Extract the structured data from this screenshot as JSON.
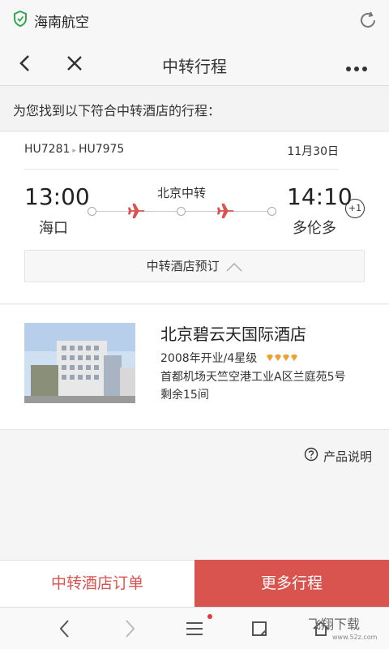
{
  "status_bar": {
    "app_name": "海南航空",
    "icons": [
      "shield-icon",
      "refresh-icon"
    ]
  },
  "nav": {
    "title": "中转行程",
    "icons": [
      "back-arrow-icon",
      "close-icon",
      "more-dots-icon"
    ]
  },
  "found_text": "为您找到以下符合中转酒店的行程：",
  "itinerary": {
    "flight1": "HU7281",
    "flight2": "HU7975",
    "separator": "▸",
    "date": "11月30日",
    "dep_time": "13:00",
    "dep_city": "海口",
    "transfer_label": "北京中转",
    "arr_time": "14:10",
    "arr_city": "多伦多",
    "plus_day": "+1",
    "hotel_booking_label": "中转酒店预订"
  },
  "hotel": {
    "name": "北京碧云天国际酒店",
    "year_rating": "2008年开业/4星级",
    "diamonds": 4,
    "address": "首都机场天竺空港工业A区兰庭苑5号",
    "rooms_left": "剩余15间"
  },
  "product_desc_label": "产品说明",
  "actions": {
    "hotel_order": "中转酒店订单",
    "more_trips": "更多行程"
  },
  "colors": {
    "accent": "#d9534f",
    "diamond": "#f0a030"
  },
  "watermark": {
    "text": "飞翔下载",
    "url": "www.52z.com"
  }
}
